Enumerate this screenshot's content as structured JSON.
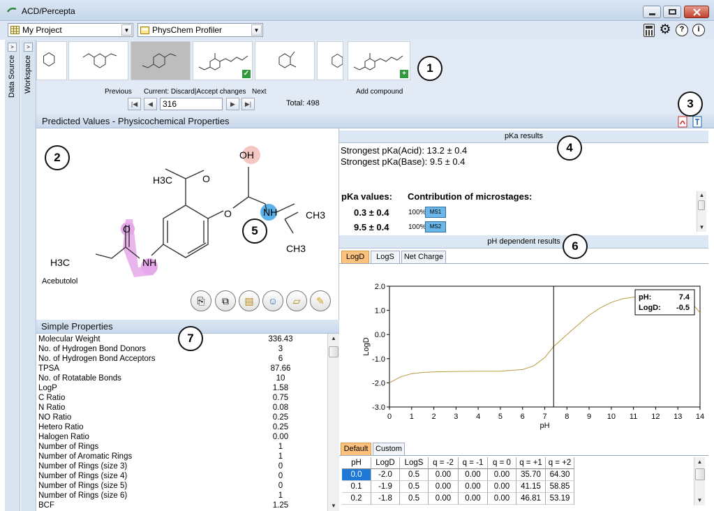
{
  "window": {
    "title": "ACD/Percepta"
  },
  "toolbar": {
    "project": "My Project",
    "module": "PhysChem Profiler"
  },
  "sidebar": {
    "data_source": "Data Source",
    "workspace": "Workspace"
  },
  "navigator": {
    "previous_label": "Previous",
    "current_label": "Current: Discard|Accept changes",
    "next_label": "Next",
    "add_label": "Add compound",
    "current_index": "316",
    "total": "Total: 498"
  },
  "callouts": [
    "1",
    "2",
    "3",
    "4",
    "5",
    "6",
    "7"
  ],
  "predicted": {
    "header": "Predicted Values - Physicochemical Properties"
  },
  "structure": {
    "name": "Acebutolol",
    "labels": {
      "oh": "OH",
      "nh_amine": "NH",
      "ch3_a": "CH3",
      "ch3_b": "CH3",
      "h3c_acetyl": "H3C",
      "o_acetyl": "O",
      "o_ether": "O",
      "o_amide": "O",
      "nh_amide": "NH",
      "h3c_chain": "H3C"
    }
  },
  "pka": {
    "header": "pKa results",
    "strongest_acid": "Strongest pKa(Acid): 13.2 ± 0.4",
    "strongest_base": "Strongest pKa(Base): 9.5 ± 0.4",
    "values_label": "pKa values:",
    "contrib_label": "Contribution of microstages:",
    "rows": [
      {
        "value": "0.3 ± 0.4",
        "pct": "100%",
        "ms": "MS1"
      },
      {
        "value": "9.5 ± 0.4",
        "pct": "100%",
        "ms": "MS2"
      }
    ]
  },
  "ph": {
    "header": "pH dependent results",
    "tabs": [
      "LogD",
      "LogS",
      "Net Charge"
    ],
    "active_tab": "LogD",
    "tooltip": {
      "ph_label": "pH:",
      "ph_value": "7.4",
      "logd_label": "LogD:",
      "logd_value": "-0.5"
    }
  },
  "chart_data": {
    "type": "line",
    "xlabel": "pH",
    "ylabel": "LogD",
    "xlim": [
      0,
      14
    ],
    "ylim": [
      -3.0,
      2.0
    ],
    "xticks": [
      "0",
      "1",
      "2",
      "3",
      "4",
      "5",
      "6",
      "7",
      "8",
      "9",
      "10",
      "11",
      "12",
      "13",
      "14"
    ],
    "yticks": [
      "2.0",
      "1.0",
      "0.0",
      "-1.0",
      "-2.0",
      "-3.0"
    ],
    "cursor_x": 7.4,
    "x": [
      0,
      0.5,
      1,
      1.5,
      2,
      3,
      4,
      5,
      6,
      6.5,
      7,
      7.4,
      8,
      8.5,
      9,
      9.5,
      10,
      10.5,
      11,
      11.5,
      12,
      12.5,
      13,
      13.5,
      14
    ],
    "y": [
      -2.0,
      -1.75,
      -1.62,
      -1.57,
      -1.55,
      -1.53,
      -1.52,
      -1.52,
      -1.45,
      -1.3,
      -0.95,
      -0.5,
      0.0,
      0.4,
      0.8,
      1.1,
      1.33,
      1.48,
      1.55,
      1.58,
      1.6,
      1.6,
      1.58,
      1.45,
      0.9
    ],
    "grid": false
  },
  "table": {
    "tabs": [
      "Default",
      "Custom"
    ],
    "active_tab": "Default",
    "columns": [
      "pH",
      "LogD",
      "LogS",
      "q = -2",
      "q = -1",
      "q = 0",
      "q = +1",
      "q = +2"
    ],
    "rows": [
      [
        "0.0",
        "-2.0",
        "0.5",
        "0.00",
        "0.00",
        "0.00",
        "35.70",
        "64.30"
      ],
      [
        "0.1",
        "-1.9",
        "0.5",
        "0.00",
        "0.00",
        "0.00",
        "41.15",
        "58.85"
      ],
      [
        "0.2",
        "-1.8",
        "0.5",
        "0.00",
        "0.00",
        "0.00",
        "46.81",
        "53.19"
      ]
    ]
  },
  "simple_properties": {
    "header": "Simple Properties",
    "rows": [
      {
        "name": "Molecular Weight",
        "value": "336.43"
      },
      {
        "name": "No. of Hydrogen Bond Donors",
        "value": "3"
      },
      {
        "name": "No. of Hydrogen Bond Acceptors",
        "value": "6"
      },
      {
        "name": "TPSA",
        "value": "87.66"
      },
      {
        "name": "No. of Rotatable Bonds",
        "value": "10"
      },
      {
        "name": "LogP",
        "value": "1.58"
      },
      {
        "name": "C Ratio",
        "value": "0.75"
      },
      {
        "name": "N Ratio",
        "value": "0.08"
      },
      {
        "name": "NO Ratio",
        "value": "0.25"
      },
      {
        "name": "Hetero Ratio",
        "value": "0.25"
      },
      {
        "name": "Halogen Ratio",
        "value": "0.00"
      },
      {
        "name": "Number of Rings",
        "value": "1"
      },
      {
        "name": "Number of Aromatic Rings",
        "value": "1"
      },
      {
        "name": "Number of Rings (size 3)",
        "value": "0"
      },
      {
        "name": "Number of Rings (size 4)",
        "value": "0"
      },
      {
        "name": "Number of Rings (size 5)",
        "value": "0"
      },
      {
        "name": "Number of Rings (size 6)",
        "value": "1"
      },
      {
        "name": "BCF",
        "value": "1.25"
      }
    ]
  }
}
